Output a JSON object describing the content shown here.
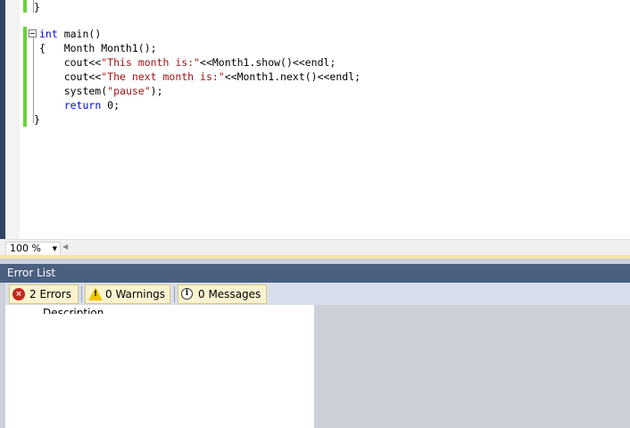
{
  "editor": {
    "lines": [
      {
        "id": "close-brace-prev",
        "segments": [
          {
            "t": "}",
            "c": ""
          }
        ]
      },
      {
        "id": "main-signature",
        "segments": [
          {
            "t": "int",
            "c": "kw"
          },
          {
            "t": " main()",
            "c": ""
          }
        ]
      },
      {
        "id": "open-brace",
        "segments": [
          {
            "t": "{   Month Month1();",
            "c": ""
          }
        ]
      },
      {
        "id": "cout-show",
        "segments": [
          {
            "t": "    cout<<",
            "c": ""
          },
          {
            "t": "\"This month is:\"",
            "c": "str"
          },
          {
            "t": "<<Month1.show()<<endl;",
            "c": ""
          }
        ]
      },
      {
        "id": "cout-next",
        "segments": [
          {
            "t": "    cout<<",
            "c": ""
          },
          {
            "t": "\"The next month is:\"",
            "c": "str"
          },
          {
            "t": "<<Month1.next()<<endl;",
            "c": ""
          }
        ]
      },
      {
        "id": "system-pause",
        "segments": [
          {
            "t": "    system(",
            "c": ""
          },
          {
            "t": "\"pause\"",
            "c": "str"
          },
          {
            "t": ");",
            "c": ""
          }
        ]
      },
      {
        "id": "return-zero",
        "segments": [
          {
            "t": "    ",
            "c": ""
          },
          {
            "t": "return",
            "c": "kw"
          },
          {
            "t": " 0;",
            "c": ""
          }
        ]
      },
      {
        "id": "close-brace-main",
        "segments": [
          {
            "t": "}",
            "c": ""
          }
        ]
      }
    ]
  },
  "zoom": {
    "value": "100 %"
  },
  "error_list": {
    "title": "Error List",
    "errors_label": "2 Errors",
    "warnings_label": "0 Warnings",
    "messages_label": "0 Messages",
    "column_header": "Description"
  },
  "colors": {
    "keyword": "#0000ff",
    "string": "#a31515",
    "panel_title_bg": "#4b5f80",
    "change_bar": "#6ad13a"
  },
  "icons": {
    "error": "error-circle-icon",
    "warning": "warning-triangle-icon",
    "info": "info-circle-icon"
  }
}
